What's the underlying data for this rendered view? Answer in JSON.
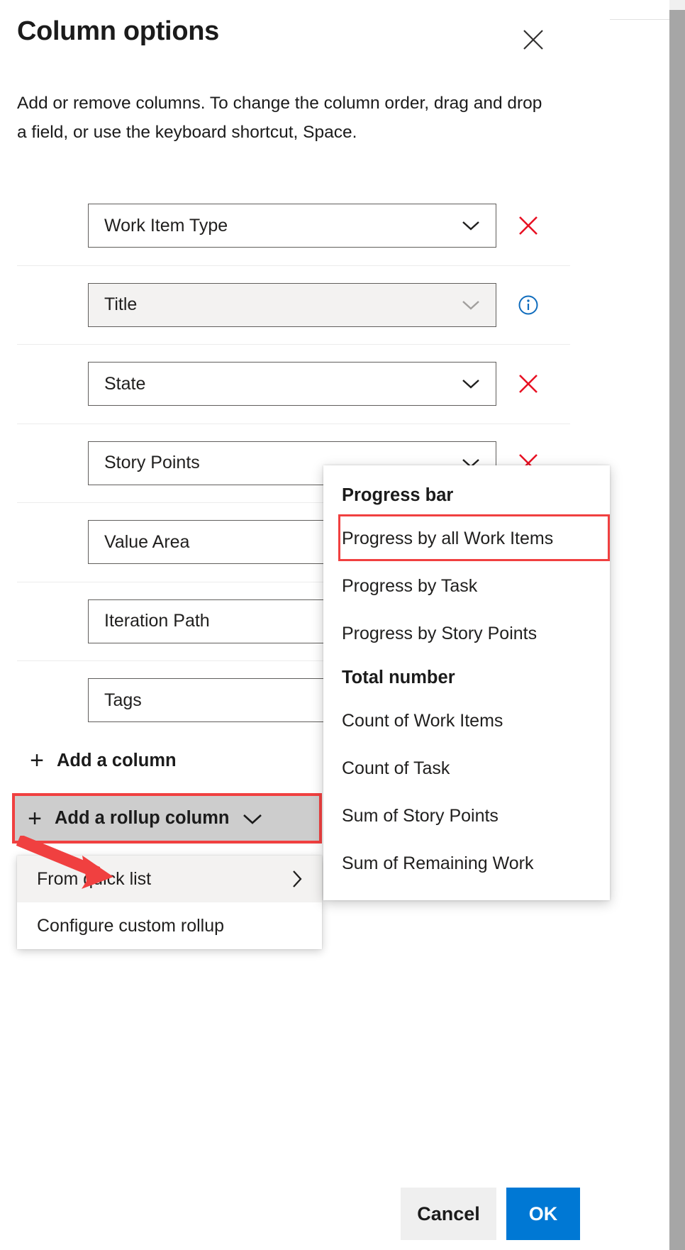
{
  "panel": {
    "title": "Column options",
    "close_icon": "close-icon",
    "description": "Add or remove columns. To change the column order, drag and drop a field, or use the keyboard shortcut, Space."
  },
  "fields": [
    {
      "label": "Work Item Type",
      "action": "remove",
      "disabled": false
    },
    {
      "label": "Title",
      "action": "info",
      "disabled": true
    },
    {
      "label": "State",
      "action": "remove",
      "disabled": false
    },
    {
      "label": "Story Points",
      "action": "remove",
      "disabled": false
    },
    {
      "label": "Value Area",
      "action": "none",
      "disabled": false
    },
    {
      "label": "Iteration Path",
      "action": "none",
      "disabled": false
    },
    {
      "label": "Tags",
      "action": "none",
      "disabled": false
    }
  ],
  "add_column": {
    "plus": "+",
    "label": "Add a column"
  },
  "add_rollup_column": {
    "plus": "+",
    "label": "Add a rollup column",
    "chevron_icon": "chevron-down-icon",
    "highlight_color": "#f04040"
  },
  "rollup_submenu": {
    "items": [
      {
        "label": "From quick list",
        "has_chevron": true,
        "highlighted": true
      },
      {
        "label": "Configure custom rollup",
        "has_chevron": false,
        "highlighted": false
      }
    ]
  },
  "quick_list_flyout": {
    "groups": [
      {
        "header": "Progress bar",
        "items": [
          {
            "label": "Progress by all Work Items",
            "outlined": true
          },
          {
            "label": "Progress by Task",
            "outlined": false
          },
          {
            "label": "Progress by Story Points",
            "outlined": false
          }
        ]
      },
      {
        "header": "Total number",
        "items": [
          {
            "label": "Count of Work Items",
            "outlined": false
          },
          {
            "label": "Count of Task",
            "outlined": false
          },
          {
            "label": "Sum of Story Points",
            "outlined": false
          },
          {
            "label": "Sum of Remaining Work",
            "outlined": false
          }
        ]
      }
    ]
  },
  "footer": {
    "cancel_label": "Cancel",
    "ok_label": "OK",
    "ok_color": "#0078d4"
  },
  "colors": {
    "remove_x": "#e81123",
    "info_blue": "#0f6cbd",
    "annotation_red": "#f04040",
    "accent": "#0078d4"
  }
}
